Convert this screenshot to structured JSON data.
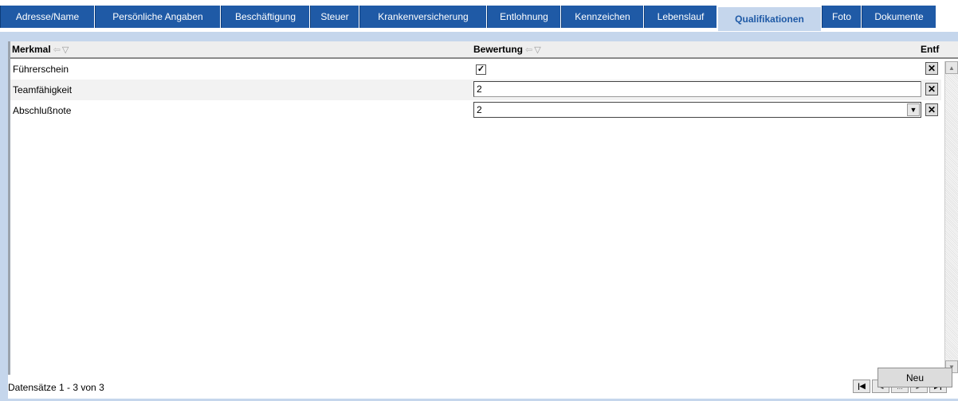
{
  "tabs": [
    {
      "label": "Adresse/Name",
      "active": false
    },
    {
      "label": "Persönliche Angaben",
      "active": false
    },
    {
      "label": "Beschäftigung",
      "active": false
    },
    {
      "label": "Steuer",
      "active": false
    },
    {
      "label": "Krankenversicherung",
      "active": false
    },
    {
      "label": "Entlohnung",
      "active": false
    },
    {
      "label": "Kennzeichen",
      "active": false
    },
    {
      "label": "Lebenslauf",
      "active": false
    },
    {
      "label": "Qualifikationen",
      "active": true
    },
    {
      "label": "Foto",
      "active": false
    },
    {
      "label": "Dokumente",
      "active": false
    }
  ],
  "grid": {
    "columns": {
      "merkmal": "Merkmal",
      "bewertung": "Bewertung",
      "entf": "Entf"
    },
    "rows": [
      {
        "merkmal": "Führerschein",
        "type": "checkbox",
        "checked": true,
        "check_glyph": "✓"
      },
      {
        "merkmal": "Teamfähigkeit",
        "type": "text",
        "value": "2"
      },
      {
        "merkmal": "Abschlußnote",
        "type": "select",
        "value": "2"
      }
    ],
    "delete_glyph": "✕"
  },
  "icons": {
    "sort": "sort-arrows-icon",
    "filter": "filter-funnel-icon",
    "scroll_up": "scroll-up-arrow-icon",
    "scroll_down": "scroll-down-arrow-icon",
    "dropdown": "dropdown-arrow-icon",
    "delete": "delete-x-icon"
  },
  "footer": {
    "status": "Datensätze 1 - 3 von 3",
    "pager": {
      "first": "|◀",
      "prev": "◀",
      "more": "...",
      "next": "▶",
      "last": "▶|"
    }
  },
  "new_button": "Neu",
  "colors": {
    "tab_bg": "#1f5aa6",
    "tab_active_bg": "#c5d6ec",
    "panel_bg": "#c5d6ec"
  }
}
